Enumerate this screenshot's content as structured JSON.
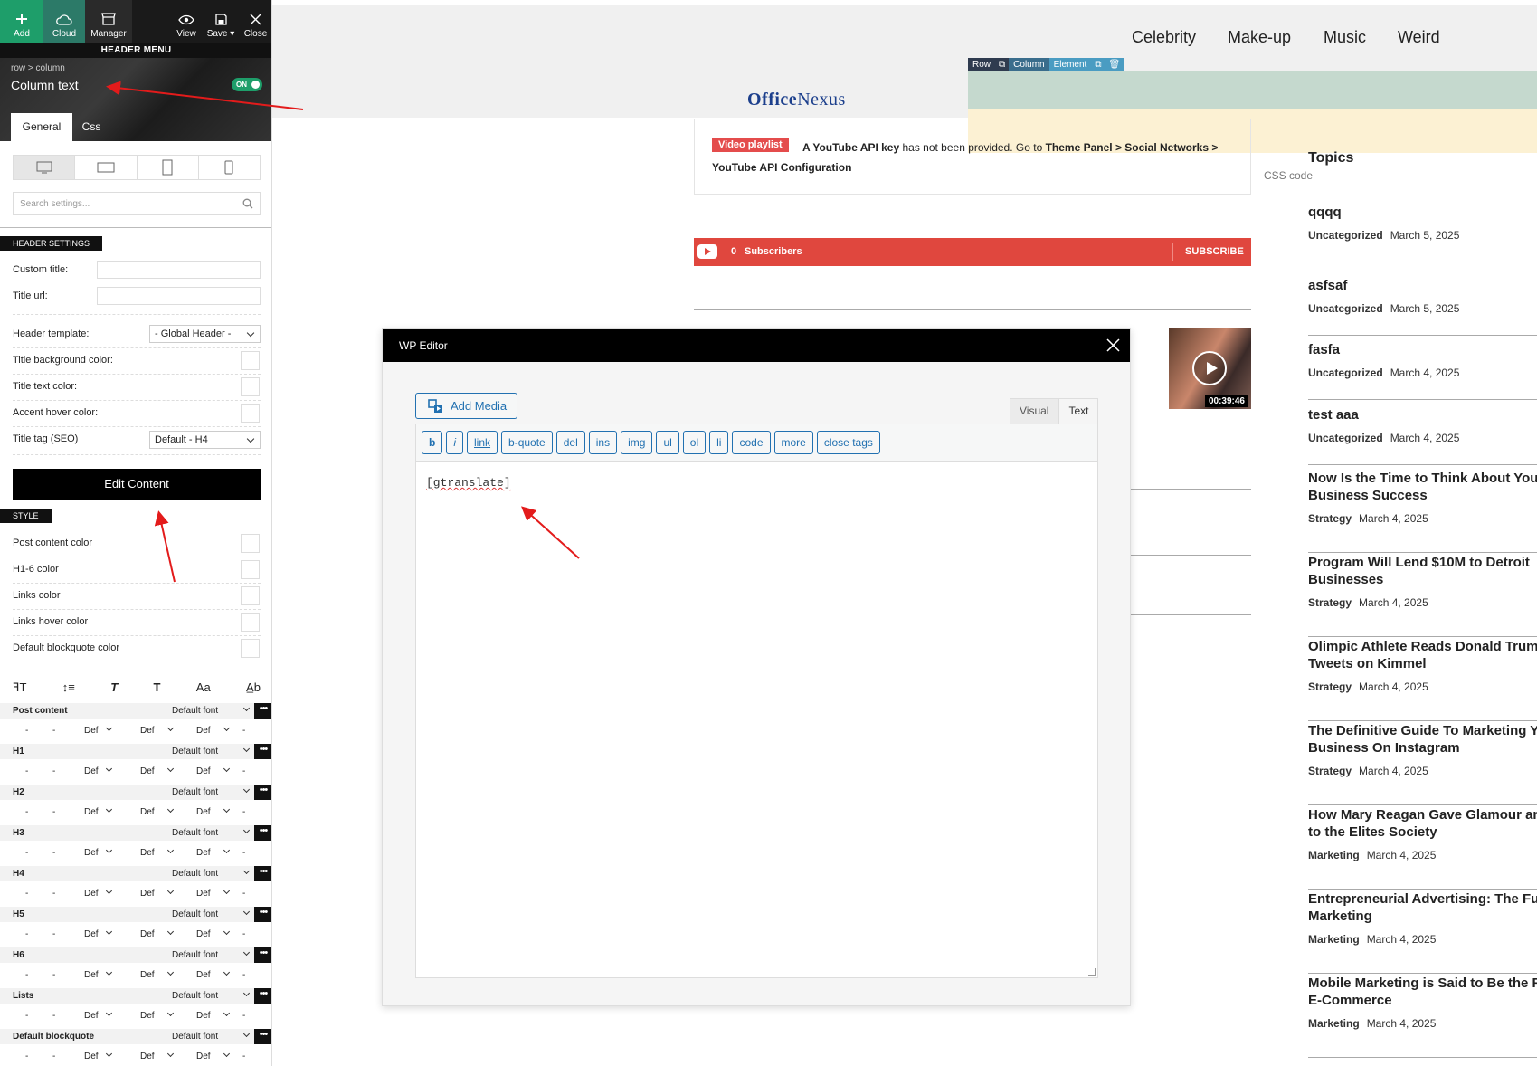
{
  "toolbar": {
    "add": "Add",
    "cloud": "Cloud",
    "manager": "Manager",
    "view": "View",
    "save": "Save",
    "close": "Close"
  },
  "header_menu": "HEADER MENU",
  "breadcrumb": {
    "row": "row",
    "sep": ">",
    "column": "column"
  },
  "element_title": "Column text",
  "toggle": "ON",
  "panel_tabs": [
    "General",
    "Css"
  ],
  "search_placeholder": "Search settings...",
  "header_settings": {
    "section": "HEADER SETTINGS",
    "custom_title": "Custom title:",
    "title_url": "Title url:",
    "header_template": "Header template:",
    "header_template_value": "- Global Header -",
    "title_bg": "Title background color:",
    "title_text": "Title text color:",
    "accent_hover": "Accent hover color:",
    "title_tag": "Title tag (SEO)",
    "title_tag_value": "Default - H4"
  },
  "edit_content": "Edit Content",
  "style": {
    "section": "STYLE",
    "items": [
      "Post content color",
      "H1-6 color",
      "Links color",
      "Links hover color",
      "Default blockquote color"
    ]
  },
  "typo_icons": [
    "font-size-icon",
    "line-height-icon",
    "italic-icon",
    "bold-icon",
    "case-icon",
    "letter-spacing-icon"
  ],
  "typo_glyphs": [
    "ꟻT",
    "↕≡",
    "T",
    "T",
    "Aa",
    "A̲b"
  ],
  "typography": {
    "rows": [
      {
        "label": "Post content",
        "font": "Default font"
      },
      {
        "label": "H1",
        "font": "Default font"
      },
      {
        "label": "H2",
        "font": "Default font"
      },
      {
        "label": "H3",
        "font": "Default font"
      },
      {
        "label": "H4",
        "font": "Default font"
      },
      {
        "label": "H5",
        "font": "Default font"
      },
      {
        "label": "H6",
        "font": "Default font"
      },
      {
        "label": "Lists",
        "font": "Default font"
      },
      {
        "label": "Default blockquote",
        "font": "Default font"
      }
    ],
    "sub": {
      "dash": "-",
      "def": "Def",
      "more": "•••"
    }
  },
  "nav": [
    "Celebrity",
    "Make-up",
    "Music",
    "Weird"
  ],
  "logo": {
    "a": "Office",
    "b": "Nexus"
  },
  "vc_bar": [
    "Row",
    "Column",
    "Element"
  ],
  "video": {
    "badge": "Video playlist",
    "text_a": "A YouTube API key",
    "text_b": " has not been provided. Go to ",
    "text_c": "Theme Panel > Social Networks > YouTube API Configuration",
    "duration": "00:39:46"
  },
  "css_code": "CSS code",
  "subscribe": {
    "count": "0",
    "label": "Subscribers",
    "button": "SUBSCRIBE"
  },
  "topics": "Topics",
  "posts": [
    {
      "title": "qqqq",
      "cat": "Uncategorized",
      "date": "March 5, 2025"
    },
    {
      "title": "asfsaf",
      "cat": "Uncategorized",
      "date": "March 5, 2025"
    },
    {
      "title": "fasfa",
      "cat": "Uncategorized",
      "date": "March 4, 2025"
    },
    {
      "title": "test aaa",
      "cat": "Uncategorized",
      "date": "March 4, 2025"
    },
    {
      "title": "Now Is the Time to Think About Your",
      "title2": "Business Success",
      "cat": "Strategy",
      "date": "March 4, 2025"
    },
    {
      "title": "Program Will Lend $10M to Detroit",
      "title2": "Businesses",
      "cat": "Strategy",
      "date": "March 4, 2025"
    },
    {
      "title": "Olimpic Athlete Reads Donald Trump's",
      "title2": "Tweets on Kimmel",
      "cat": "Strategy",
      "date": "March 4, 2025"
    },
    {
      "title": "The Definitive Guide To Marketing Your",
      "title2": "Business On Instagram",
      "cat": "Strategy",
      "date": "March 4, 2025"
    },
    {
      "title": "How Mary Reagan Gave Glamour and",
      "title2": "to the Elites Society",
      "cat": "Marketing",
      "date": "March 4, 2025"
    },
    {
      "title": "Entrepreneurial Advertising: The Future of",
      "title2": "Marketing",
      "cat": "Marketing",
      "date": "March 4, 2025"
    },
    {
      "title": "Mobile Marketing is Said to Be the Future of",
      "title2": "E-Commerce",
      "cat": "Marketing",
      "date": "March 4, 2025"
    }
  ],
  "wp_editor": {
    "title": "WP Editor",
    "add_media": "Add Media",
    "tabs": [
      "Visual",
      "Text"
    ],
    "quicktags": [
      "b",
      "i",
      "link",
      "b-quote",
      "del",
      "ins",
      "img",
      "ul",
      "ol",
      "li",
      "code",
      "more",
      "close tags"
    ],
    "content": "[gtranslate]"
  },
  "colors": {
    "accent_green": "#1e9e6a",
    "subscribe_red": "#e0473e",
    "wp_blue": "#2271b1",
    "logo_blue": "#1c3f8c"
  }
}
